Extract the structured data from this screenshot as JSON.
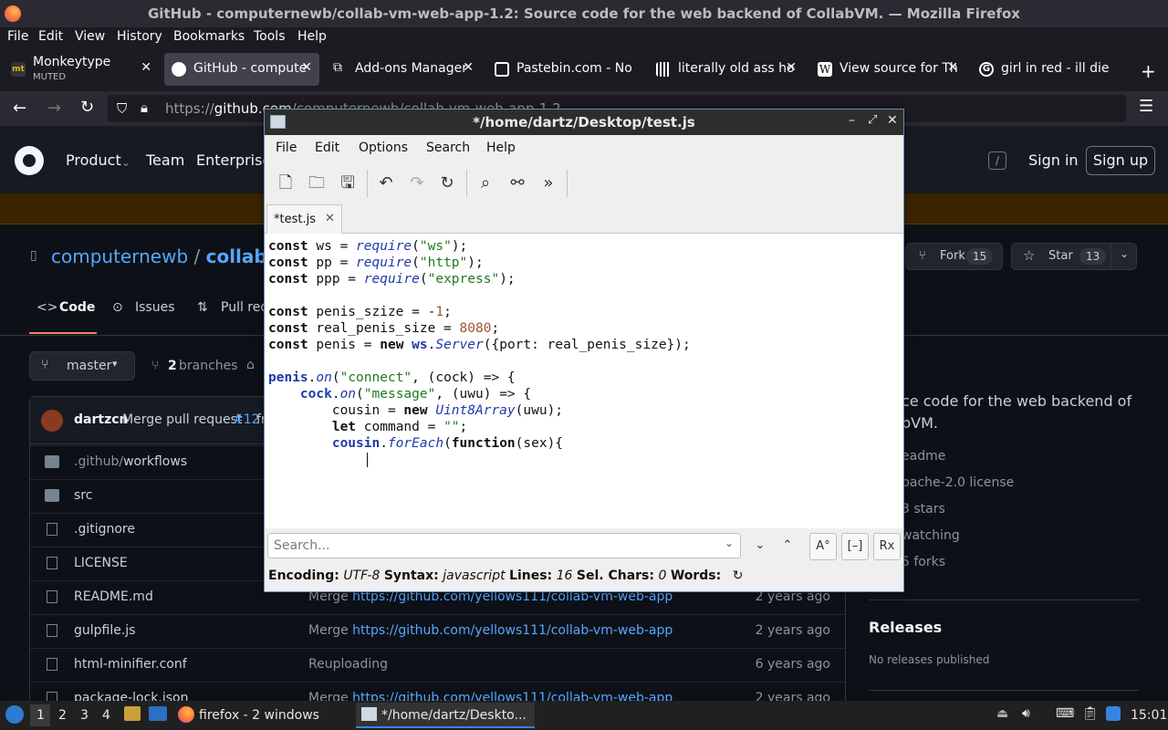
{
  "window": {
    "title": "GitHub - computernewb/collab-vm-web-app-1.2: Source code for the web backend of CollabVM. — Mozilla Firefox"
  },
  "menubar": [
    "File",
    "Edit",
    "View",
    "History",
    "Bookmarks",
    "Tools",
    "Help"
  ],
  "tabs": [
    {
      "label": "Monkeytype",
      "sub": "MUTED",
      "icon_color": "#e2b714"
    },
    {
      "label": "GitHub - compute",
      "icon_color": "#ffffff"
    },
    {
      "label": "Add-ons Manager",
      "icon_color": "#fbfbfe"
    },
    {
      "label": "Pastebin.com - No",
      "icon_color": "#ffffff"
    },
    {
      "label": "literally old ass ho",
      "icon_color": "#ffffff"
    },
    {
      "label": "View source for Th",
      "icon_color": "#ffffff"
    },
    {
      "label": "girl in red - ill die",
      "icon_color": "#ffffff"
    }
  ],
  "url": {
    "prefix": "https://",
    "host": "github.com",
    "rest": "/computernewb/collab-vm-web-app-1.2"
  },
  "github": {
    "nav": [
      "Product",
      "Team",
      "Enterprise"
    ],
    "sign_in": "Sign in",
    "sign_up": "Sign up",
    "search_key": "/",
    "owner": "computernewb",
    "sep": "/",
    "repo": "collab-vm",
    "fork_label": "Fork",
    "fork_count": "15",
    "star_label": "Star",
    "star_count": "13",
    "repo_tabs": [
      "Code",
      "Issues",
      "Pull requ"
    ],
    "branch": "master",
    "branches_count": "2",
    "branches_label": "branches",
    "commit_author": "dartzcn",
    "commit_msg": "Merge pull request",
    "commit_pr": "#12",
    "commit_tail": "fr",
    "files": [
      {
        "name": ".github/workflows",
        "type": "dir",
        "msg": "",
        "link": "",
        "age": ""
      },
      {
        "name": "src",
        "type": "dir",
        "msg": "",
        "link": "",
        "age": ""
      },
      {
        "name": ".gitignore",
        "type": "file",
        "msg": "",
        "link": "",
        "age": ""
      },
      {
        "name": "LICENSE",
        "type": "file",
        "msg": "",
        "link": "",
        "age": ""
      },
      {
        "name": "README.md",
        "type": "file",
        "msg": "Merge ",
        "link": "https://github.com/yellows111/collab-vm-web-app",
        "age": "2 years ago"
      },
      {
        "name": "gulpfile.js",
        "type": "file",
        "msg": "Merge ",
        "link": "https://github.com/yellows111/collab-vm-web-app",
        "age": "2 years ago"
      },
      {
        "name": "html-minifier.conf",
        "type": "file",
        "msg": "Reuploading",
        "link": "",
        "age": "6 years ago"
      },
      {
        "name": "package-lock.json",
        "type": "file",
        "msg": "Merge ",
        "link": "https://github.com/yellows111/collab-vm-web-app",
        "age": "2 years ago"
      }
    ],
    "about_heading": "t",
    "about_desc_1": "ce code for the web backend of",
    "about_desc_2": "bVM.",
    "about_items": [
      "eadme",
      "pache-2.0 license",
      "3 stars",
      "watching",
      "5 forks"
    ],
    "releases_heading": "Releases",
    "releases_empty": "No releases published"
  },
  "editor": {
    "title": "*/home/dartz/Desktop/test.js",
    "menu": [
      "File",
      "Edit",
      "Options",
      "Search",
      "Help"
    ],
    "tab_label": "*test.js",
    "search_placeholder": "Search...",
    "status": {
      "encoding_label": "Encoding:",
      "encoding": "UTF-8",
      "syntax_label": "Syntax:",
      "syntax": "javascript",
      "lines_label": "Lines:",
      "lines": "16",
      "sel_label": "Sel. Chars:",
      "sel": "0",
      "words_label": "Words:"
    }
  },
  "taskbar": {
    "workspaces": [
      "1",
      "2",
      "3",
      "4"
    ],
    "firefox_label": "firefox - 2 windows",
    "editor_label": "*/home/dartz/Deskto...",
    "clock": "15:01"
  },
  "colors": {
    "accent": "#f78166",
    "link": "#58a6ff",
    "banner": "#3b2300"
  }
}
